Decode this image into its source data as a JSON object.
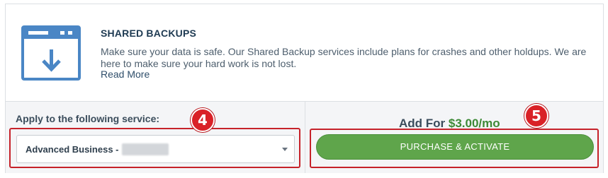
{
  "info": {
    "title": "SHARED BACKUPS",
    "description": "Make sure your data is safe. Our Shared Backup services include plans for crashes and other holdups. We are here to make sure your hard work is not lost.",
    "read_more": "Read More",
    "icon": "browser-download-icon",
    "icon_color": "#4a86c5"
  },
  "apply": {
    "label": "Apply to the following service:",
    "selected_value": "Advanced Business -"
  },
  "pricing": {
    "prefix": "Add For ",
    "price": "$3.00/mo",
    "price_color": "#3d8a36"
  },
  "purchase": {
    "label": "PURCHASE & ACTIVATE",
    "color": "#5fa54b"
  },
  "annotations": {
    "step_4": "4",
    "step_5": "5",
    "badge_color": "#d92127"
  }
}
